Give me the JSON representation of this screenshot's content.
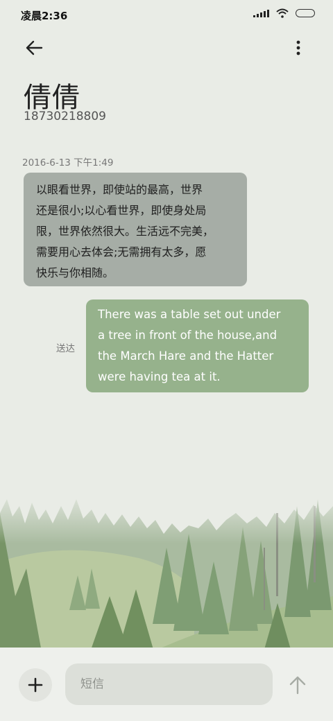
{
  "status_bar": {
    "time": "凌晨2:36"
  },
  "header": {
    "contact_name": "倩倩",
    "contact_number": "18730218809"
  },
  "messages": [
    {
      "direction": "received",
      "timestamp": "2016-6-13 下午1:49",
      "text": "以眼看世界，即使站的最高，世界\n还是很小;以心看世界，即使身处局\n限，世界依然很大。生活远不完美，\n需要用心去体会;无需拥有太多，愿\n快乐与你相随。"
    },
    {
      "direction": "sent",
      "status": "送达",
      "text": "There was a table set out under\na tree in front of the house,and\nthe March Hare and the Hatter\nwere having tea at it."
    }
  ],
  "composer": {
    "placeholder": "短信"
  },
  "colors": {
    "background": "#e9ece6",
    "received_bubble": "#a6ada6",
    "sent_bubble": "#96b28c"
  },
  "icons": {
    "back": "arrow-left-icon",
    "more": "more-vertical-icon",
    "add": "plus-icon",
    "send": "arrow-up-icon"
  }
}
